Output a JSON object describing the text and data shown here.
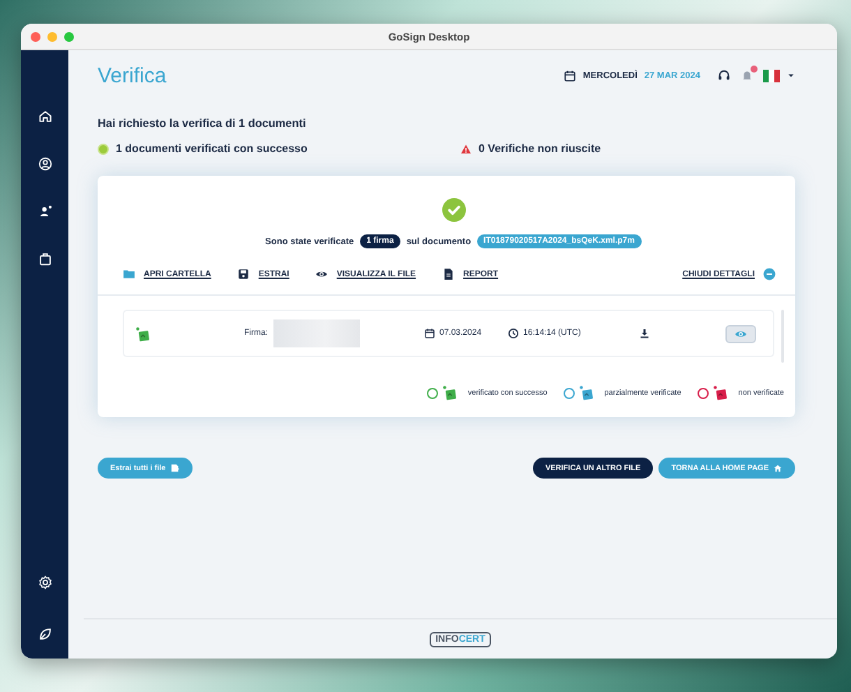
{
  "window": {
    "title": "GoSign Desktop"
  },
  "header": {
    "title": "Verifica",
    "weekday": "MERCOLEDÌ",
    "date": "27 MAR 2024",
    "has_notifications": true
  },
  "summary": {
    "request": "Hai richiesto la verifica di 1 documenti",
    "results": [
      {
        "kind": "success",
        "text": "1 documenti verificati con successo"
      },
      {
        "kind": "failure",
        "text": "0 Verifiche non riuscite"
      }
    ]
  },
  "card": {
    "sentence_start": "Sono state verificate",
    "signatures_badge": "1 firma",
    "sentence_middle": "sul documento",
    "document": "IT01879020517A2024_bsQeK.xml.p7m",
    "actions": [
      {
        "kind": "folder",
        "label": "APRI CARTELLA"
      },
      {
        "kind": "save",
        "label": "ESTRAI"
      },
      {
        "kind": "view",
        "label": "VISUALIZZA IL FILE"
      },
      {
        "kind": "report",
        "label": "REPORT"
      }
    ],
    "details_toggle": "CHIUDI DETTAGLI",
    "details_expanded": true,
    "signatures": [
      {
        "kind": "success",
        "label": "Firma:",
        "date": "07.03.2024",
        "time": "16:14:14 (UTC)"
      }
    ],
    "legend": [
      {
        "text": "verificato con successo",
        "color": "#3fae49"
      },
      {
        "text": "parzialmente verificate",
        "color": "#3aa6d0"
      },
      {
        "text": "non verificate",
        "color": "#d81e4a"
      }
    ]
  },
  "buttons": [
    {
      "kind": "extract",
      "label": "Estrai tutti i file"
    },
    {
      "kind": "primary",
      "label": "VERIFICA UN ALTRO FILE"
    },
    {
      "kind": "home",
      "label": "TORNA ALLA HOME PAGE"
    }
  ],
  "footer": {
    "logo_left": "INFO",
    "logo_right": "CERT"
  }
}
